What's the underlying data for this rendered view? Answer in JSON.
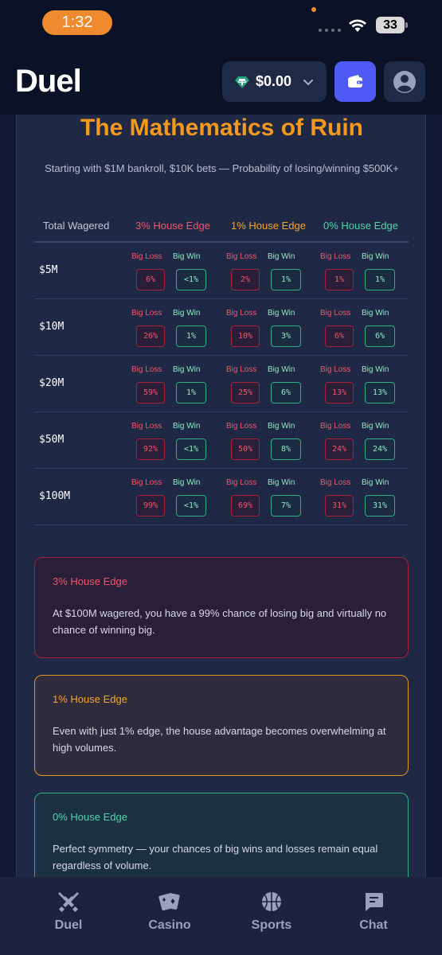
{
  "status_bar": {
    "time": "1:32",
    "battery": "33"
  },
  "header": {
    "logo": "Duel",
    "balance": "$0.00",
    "currency_icon": "tether-icon"
  },
  "main": {
    "title": "The Mathematics of Ruin",
    "subtitle": "Starting with $1M bankroll, $10K bets — Probability of losing/winning $500K+",
    "table": {
      "headers": [
        "Total Wagered",
        "3% House Edge",
        "1% House Edge",
        "0% House Edge"
      ],
      "loss_label": "Big Loss",
      "win_label": "Big Win",
      "rows": [
        {
          "wagered": "$5M",
          "edge3": {
            "loss": "6%",
            "win": "<1%"
          },
          "edge1": {
            "loss": "2%",
            "win": "1%"
          },
          "edge0": {
            "loss": "1%",
            "win": "1%"
          }
        },
        {
          "wagered": "$10M",
          "edge3": {
            "loss": "26%",
            "win": "1%"
          },
          "edge1": {
            "loss": "10%",
            "win": "3%"
          },
          "edge0": {
            "loss": "6%",
            "win": "6%"
          }
        },
        {
          "wagered": "$20M",
          "edge3": {
            "loss": "59%",
            "win": "1%"
          },
          "edge1": {
            "loss": "25%",
            "win": "6%"
          },
          "edge0": {
            "loss": "13%",
            "win": "13%"
          }
        },
        {
          "wagered": "$50M",
          "edge3": {
            "loss": "92%",
            "win": "<1%"
          },
          "edge1": {
            "loss": "50%",
            "win": "8%"
          },
          "edge0": {
            "loss": "24%",
            "win": "24%"
          }
        },
        {
          "wagered": "$100M",
          "edge3": {
            "loss": "99%",
            "win": "<1%"
          },
          "edge1": {
            "loss": "69%",
            "win": "7%"
          },
          "edge0": {
            "loss": "31%",
            "win": "31%"
          }
        }
      ]
    },
    "notes": [
      {
        "title": "3% House Edge",
        "body": "At $100M wagered, you have a 99% chance of losing big and virtually no chance of winning big."
      },
      {
        "title": "1% House Edge",
        "body": "Even with just 1% edge, the house advantage becomes overwhelming at high volumes."
      },
      {
        "title": "0% House Edge",
        "body": "Perfect symmetry — your chances of big wins and losses remain equal regardless of volume."
      }
    ]
  },
  "bottom_nav": {
    "items": [
      {
        "label": "Duel",
        "icon": "crossed-swords-icon"
      },
      {
        "label": "Casino",
        "icon": "cards-icon"
      },
      {
        "label": "Sports",
        "icon": "basketball-icon"
      },
      {
        "label": "Chat",
        "icon": "chat-icon"
      }
    ]
  },
  "colors": {
    "accent_orange": "#f5991e",
    "loss_red": "#f0566b",
    "win_green": "#4fd6a8",
    "wallet_blue": "#4f5af5"
  }
}
